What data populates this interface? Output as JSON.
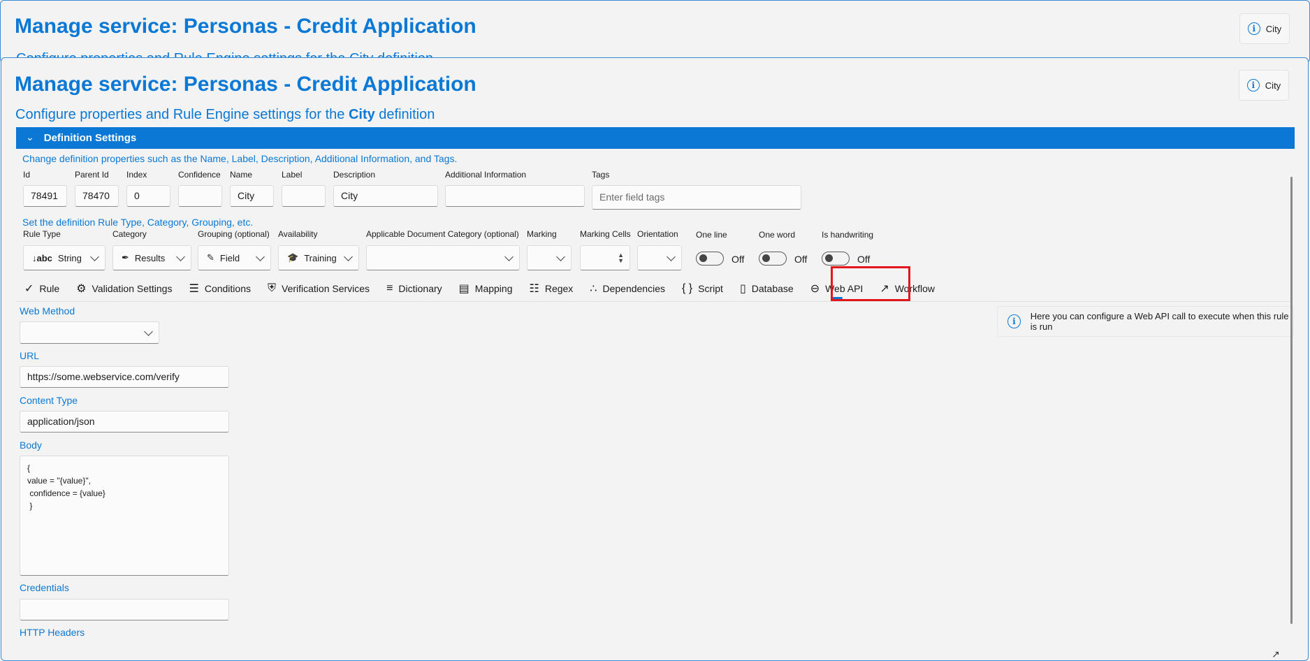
{
  "back_window": {
    "title": "Manage service: Personas - Credit Application",
    "subtitle_peek": "Configure properties and Rule Engine settings for the City definition",
    "chip_label": "City"
  },
  "window": {
    "title": "Manage service: Personas - Credit Application",
    "subtitle_prefix": "Configure properties and Rule Engine settings for the ",
    "subtitle_bold": "City",
    "subtitle_suffix": " definition",
    "chip_label": "City"
  },
  "section": {
    "title": "Definition Settings",
    "props_helper": "Change definition properties such as the Name, Label, Description, Additional Information, and Tags.",
    "fields": {
      "id": {
        "label": "Id",
        "value": "78491"
      },
      "parent_id": {
        "label": "Parent Id",
        "value": "78470"
      },
      "index": {
        "label": "Index",
        "value": "0"
      },
      "confidence": {
        "label": "Confidence",
        "value": ""
      },
      "name": {
        "label": "Name",
        "value": "City"
      },
      "label": {
        "label": "Label",
        "value": ""
      },
      "description": {
        "label": "Description",
        "value": "City"
      },
      "additional_info": {
        "label": "Additional Information",
        "value": ""
      },
      "tags": {
        "label": "Tags",
        "placeholder": "Enter field tags"
      }
    },
    "rule_helper": "Set the definition Rule Type, Category, Grouping, etc.",
    "selects": {
      "rule_type": {
        "label": "Rule Type",
        "value": "String",
        "icon": "abc-icon"
      },
      "category": {
        "label": "Category",
        "value": "Results",
        "icon": "pen-icon"
      },
      "grouping": {
        "label": "Grouping (optional)",
        "value": "Field",
        "icon": "pencil-icon"
      },
      "availability": {
        "label": "Availability",
        "value": "Training",
        "icon": "grad-cap-icon"
      },
      "doc_category": {
        "label": "Applicable Document Category (optional)",
        "value": ""
      },
      "marking": {
        "label": "Marking",
        "value": ""
      },
      "marking_cells": {
        "label": "Marking Cells",
        "value": ""
      },
      "orientation": {
        "label": "Orientation",
        "value": ""
      }
    },
    "toggles": {
      "one_line": {
        "label": "One line",
        "state": "Off"
      },
      "one_word": {
        "label": "One word",
        "state": "Off"
      },
      "handwriting": {
        "label": "Is handwriting",
        "state": "Off"
      }
    }
  },
  "tabs": [
    {
      "label": "Rule",
      "icon": "check-icon"
    },
    {
      "label": "Validation Settings",
      "icon": "validation-icon"
    },
    {
      "label": "Conditions",
      "icon": "list-icon"
    },
    {
      "label": "Verification Services",
      "icon": "shield-icon"
    },
    {
      "label": "Dictionary",
      "icon": "dictionary-icon"
    },
    {
      "label": "Mapping",
      "icon": "book-icon"
    },
    {
      "label": "Regex",
      "icon": "regex-icon"
    },
    {
      "label": "Dependencies",
      "icon": "share-icon"
    },
    {
      "label": "Script",
      "icon": "braces-icon"
    },
    {
      "label": "Database",
      "icon": "database-icon"
    },
    {
      "label": "Web API",
      "icon": "webapi-icon",
      "active": true
    },
    {
      "label": "Workflow",
      "icon": "workflow-icon"
    }
  ],
  "webapi": {
    "method_label": "Web Method",
    "method_value": "",
    "url_label": "URL",
    "url_value": "https://some.webservice.com/verify",
    "content_type_label": "Content Type",
    "content_type_value": "application/json",
    "body_label": "Body",
    "body_value": "{\nvalue = \"{value}\",\n confidence = {value}\n }",
    "credentials_label": "Credentials",
    "credentials_value": "",
    "headers_label": "HTTP Headers",
    "tip": "Here you can configure a Web API call to execute when this rule is run"
  },
  "colors": {
    "accent": "#0a78d4",
    "highlight": "#e3161c",
    "background": "#f3f3f3"
  }
}
